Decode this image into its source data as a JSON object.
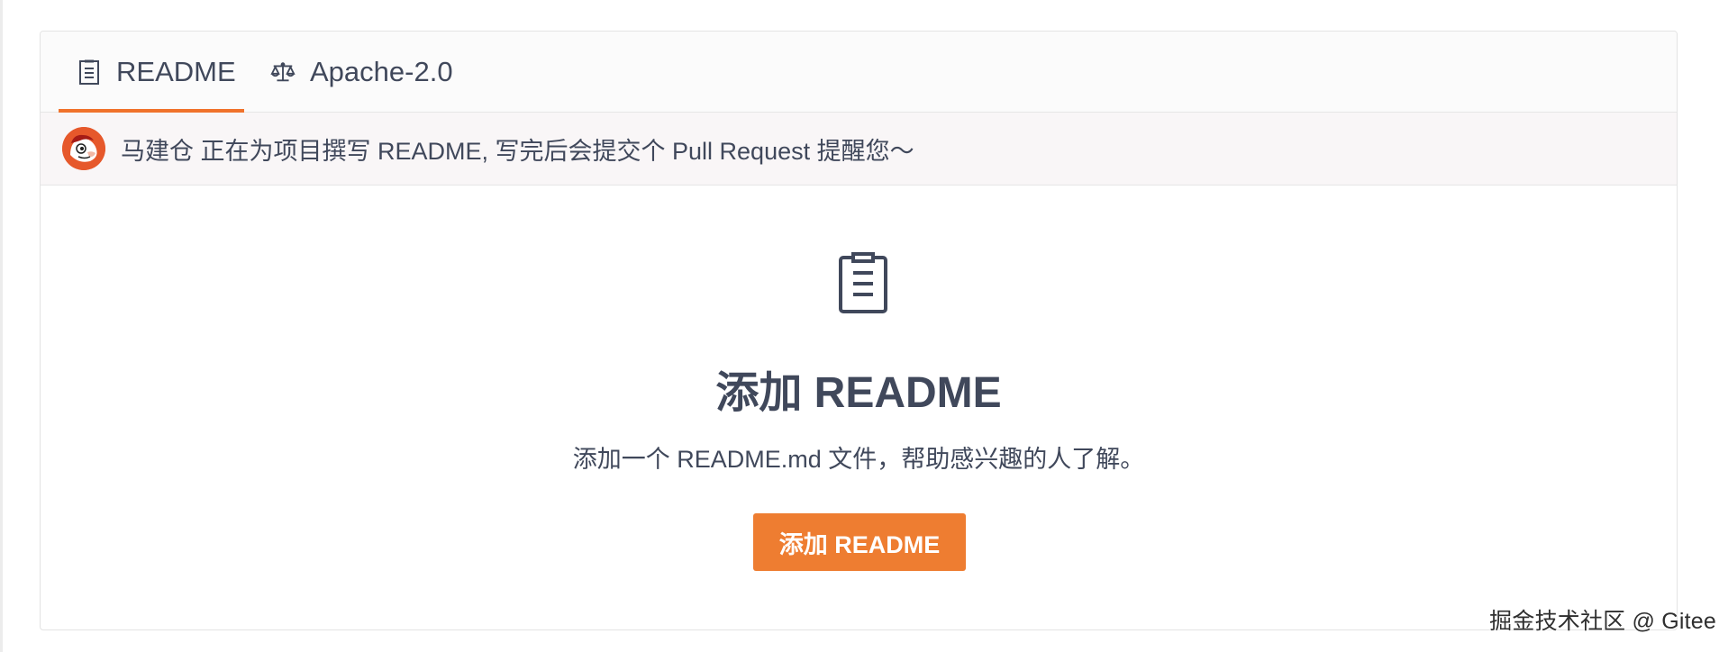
{
  "tabs": [
    {
      "label": "README",
      "icon": "document-icon",
      "active": true
    },
    {
      "label": "Apache-2.0",
      "icon": "scale-icon",
      "active": false
    }
  ],
  "notice": {
    "text": "马建仓 正在为项目撰写 README, 写完后会提交个 Pull Request 提醒您～",
    "avatar": "avatar"
  },
  "empty_state": {
    "icon": "document-icon",
    "title": "添加 README",
    "description": "添加一个 README.md 文件，帮助感兴趣的人了解。",
    "button_label": "添加 README"
  },
  "watermark": "掘金技术社区 @ Gitee",
  "colors": {
    "accent": "#f0722b",
    "button": "#ee7d31",
    "text": "#40485b"
  }
}
